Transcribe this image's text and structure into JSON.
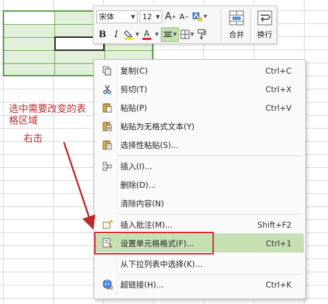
{
  "toolbar": {
    "font_name": "宋体",
    "font_size": "12",
    "grow_font_label": "A",
    "shrink_font_label": "A",
    "bold_label": "B",
    "italic_label": "I",
    "font_color_label": "A",
    "merge_label": "合并",
    "wrap_label": "换行"
  },
  "context_menu": {
    "items": [
      {
        "label": "复制(C)",
        "shortcut": "Ctrl+C",
        "icon": "copy-icon"
      },
      {
        "label": "剪切(T)",
        "shortcut": "Ctrl+X",
        "icon": "scissors-icon"
      },
      {
        "label": "粘贴(P)",
        "shortcut": "Ctrl+V",
        "icon": "paste-icon"
      },
      {
        "label": "粘贴为无格式文本(Y)",
        "shortcut": "",
        "icon": "paste-text-icon"
      },
      {
        "label": "选择性粘贴(S)...",
        "shortcut": "",
        "icon": "paste-special-icon"
      },
      {
        "label": "插入(I)...",
        "shortcut": "",
        "icon": "insert-cells-icon"
      },
      {
        "label": "删除(D)...",
        "shortcut": "",
        "icon": ""
      },
      {
        "label": "清除内容(N)",
        "shortcut": "",
        "icon": ""
      },
      {
        "label": "插入批注(M)...",
        "shortcut": "Shift+F2",
        "icon": "comment-icon"
      },
      {
        "label": "设置单元格格式(F)...",
        "shortcut": "Ctrl+1",
        "icon": "format-cells-icon"
      },
      {
        "label": "从下拉列表中选择(K)...",
        "shortcut": "",
        "icon": ""
      },
      {
        "label": "超链接(H)...",
        "shortcut": "Ctrl+K",
        "icon": "hyperlink-icon"
      }
    ]
  },
  "annotation": {
    "line1": "选中需要改变的表格区域",
    "line2": "右击"
  },
  "colors": {
    "selection_fill": "#e2efda",
    "selection_border": "#5b9b42",
    "hover_fill": "#c6e0b4",
    "annotation_red": "#c0282d"
  }
}
